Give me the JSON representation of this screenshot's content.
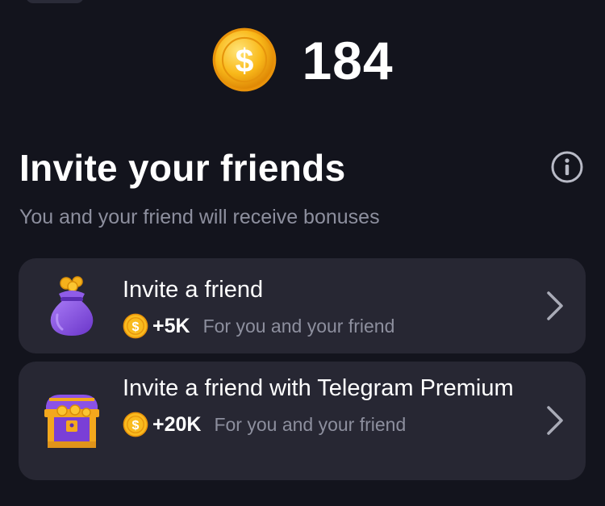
{
  "balance": {
    "value": "184",
    "coin_icon": "dollar-coin-icon"
  },
  "section": {
    "title": "Invite your friends",
    "subtitle": "You and your friend will receive bonuses",
    "info_icon": "info-circle-icon"
  },
  "cards": [
    {
      "title": "Invite a friend",
      "reward_amount": "+5K",
      "reward_desc": "For you and your friend",
      "icon": "gift-bag-icon"
    },
    {
      "title": "Invite a friend with Telegram Premium",
      "reward_amount": "+20K",
      "reward_desc": "For you and your friend",
      "icon": "treasure-chest-icon"
    }
  ],
  "colors": {
    "background": "#13141d",
    "card": "#272733",
    "muted_text": "#8d8f9e",
    "coin_gold": "#f7b81c",
    "purple": "#8a55e0"
  }
}
